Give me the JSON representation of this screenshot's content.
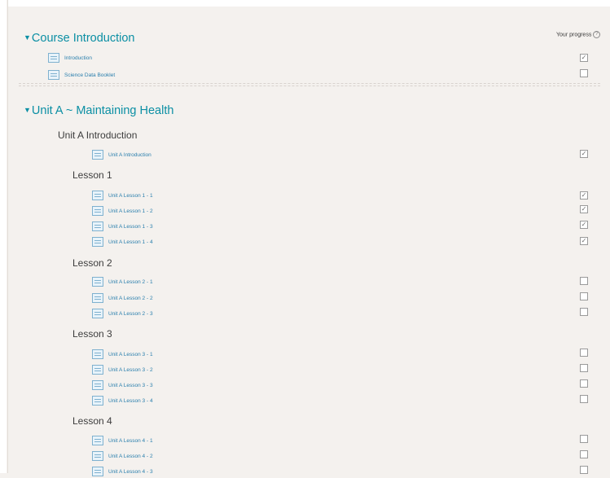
{
  "progress": {
    "label": "Your progress"
  },
  "sections": [
    {
      "title": "Course Introduction",
      "activities": [
        {
          "label": "Introduction",
          "completed": true
        },
        {
          "label": "Science Data Booklet",
          "completed": false
        }
      ]
    },
    {
      "title": "Unit A ~ Maintaining Health",
      "groups": [
        {
          "label": "Unit A Introduction",
          "activities": [
            {
              "label": "Unit A Introduction",
              "completed": true
            }
          ]
        },
        {
          "label": "Lesson 1",
          "activities": [
            {
              "label": "Unit A Lesson 1 - 1",
              "completed": true
            },
            {
              "label": "Unit A Lesson 1 - 2",
              "completed": true
            },
            {
              "label": "Unit A Lesson 1 - 3",
              "completed": true
            },
            {
              "label": "Unit A Lesson 1 - 4",
              "completed": true
            }
          ]
        },
        {
          "label": "Lesson 2",
          "activities": [
            {
              "label": "Unit A Lesson 2 - 1",
              "completed": false
            },
            {
              "label": "Unit A Lesson 2 - 2",
              "completed": false
            },
            {
              "label": "Unit A Lesson 2 - 3",
              "completed": false
            }
          ]
        },
        {
          "label": "Lesson 3",
          "activities": [
            {
              "label": "Unit A Lesson 3 - 1",
              "completed": false
            },
            {
              "label": "Unit A Lesson 3 - 2",
              "completed": false
            },
            {
              "label": "Unit A Lesson 3 - 3",
              "completed": false
            },
            {
              "label": "Unit A Lesson 3 - 4",
              "completed": false
            }
          ]
        },
        {
          "label": "Lesson 4",
          "activities": [
            {
              "label": "Unit A Lesson 4 - 1",
              "completed": false
            },
            {
              "label": "Unit A Lesson 4 - 2",
              "completed": false
            },
            {
              "label": "Unit A Lesson 4 - 3",
              "completed": false
            }
          ]
        }
      ]
    }
  ],
  "colors": {
    "accent": "#0b8fa4",
    "link": "#2a7fad",
    "background": "#f4f1ee"
  }
}
